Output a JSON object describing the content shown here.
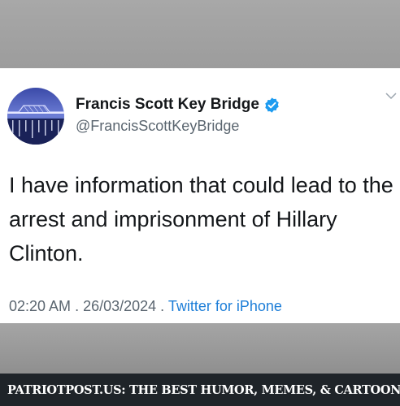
{
  "tweet": {
    "display_name": "Francis Scott Key Bridge",
    "handle": "@FrancisScottKeyBridge",
    "text": "I have information that could lead to the arrest and imprisonment of Hillary Clinton.",
    "time": "02:20 AM",
    "date": "26/03/2024",
    "source": "Twitter for iPhone",
    "separator": " . "
  },
  "footer": {
    "text": "PATRIOTPOST.US: THE BEST HUMOR, MEMES, & CARTOONS"
  },
  "colors": {
    "verified_badge": "#1d9bf0",
    "link": "#1d7ed8",
    "footer_bg": "#1f2429"
  }
}
